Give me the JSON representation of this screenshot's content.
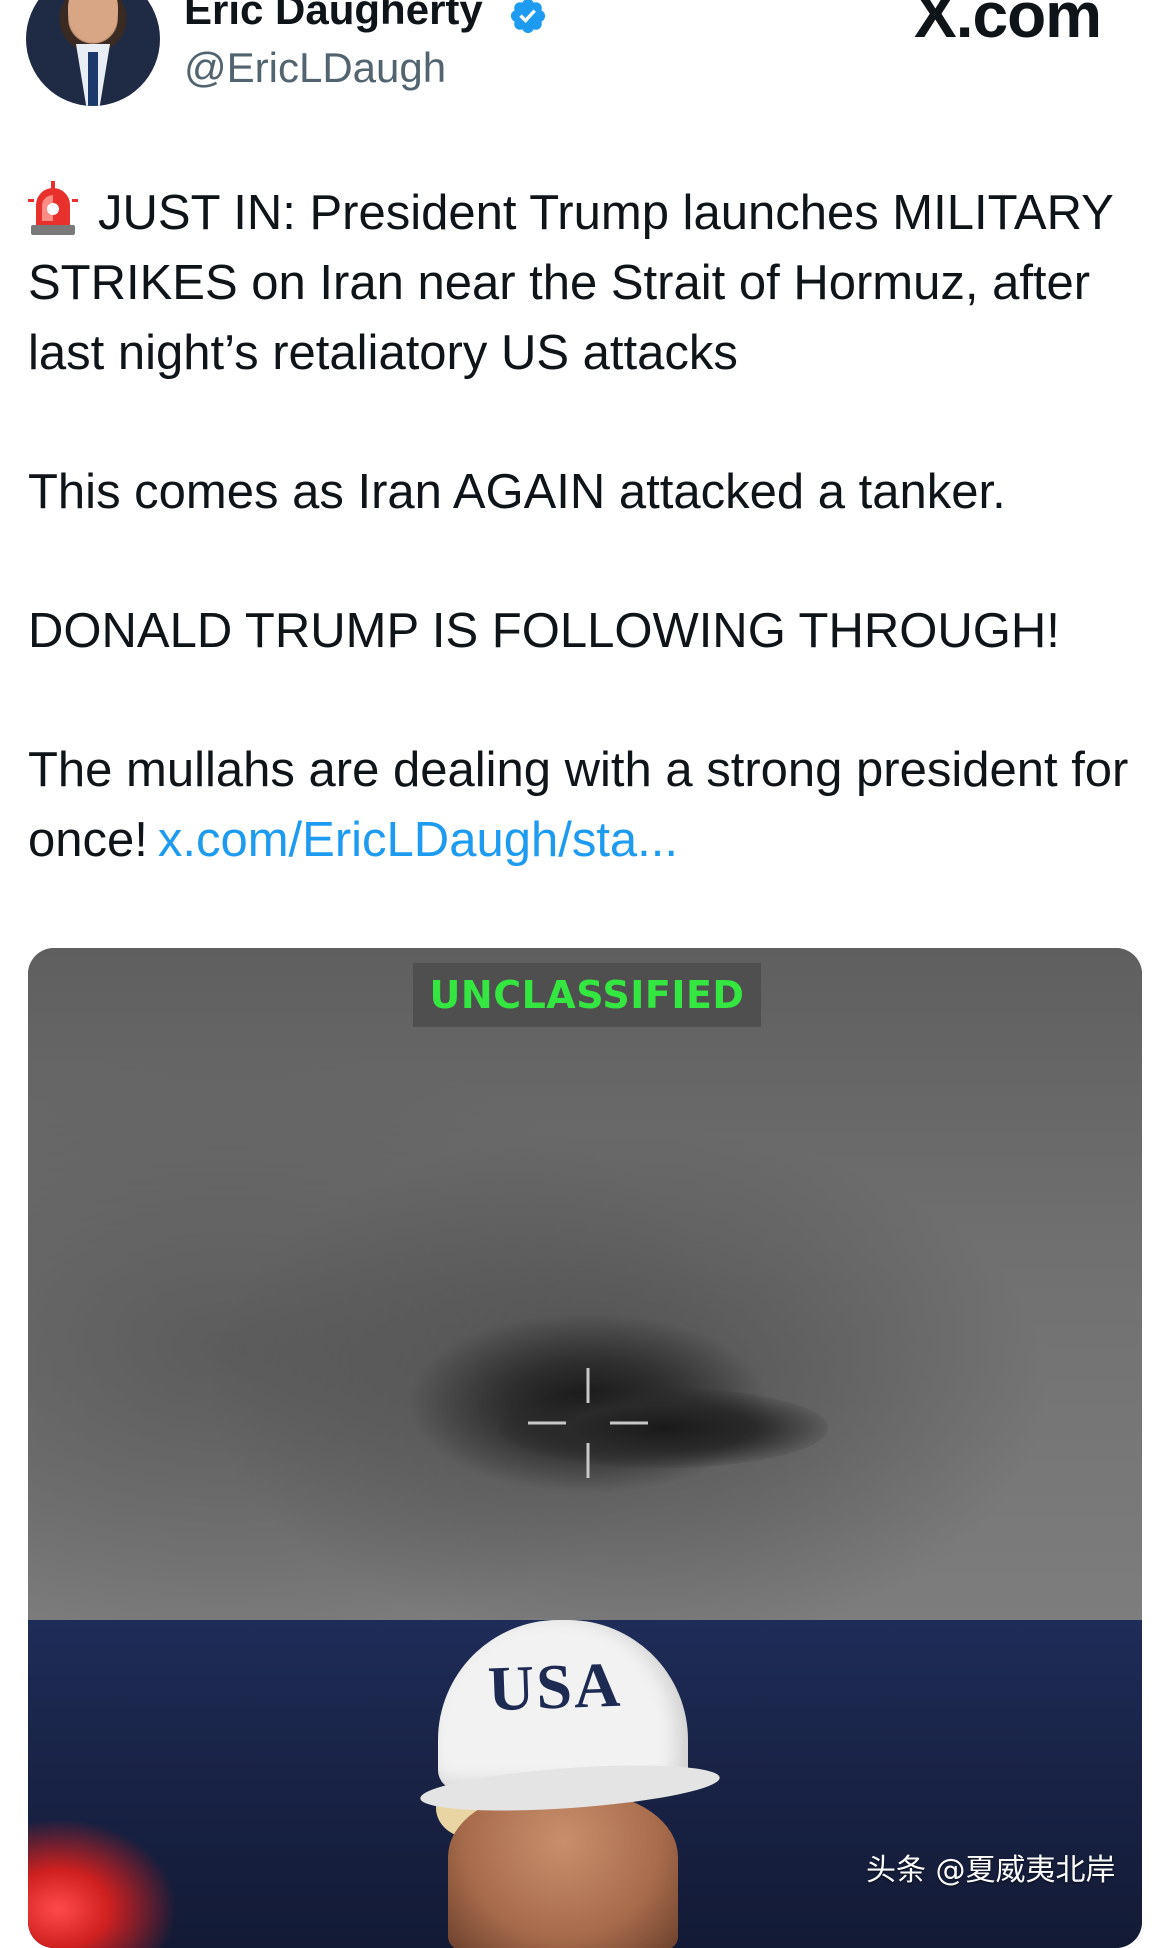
{
  "author": {
    "display_name": "Eric Daugherty",
    "handle": "@EricLDaugh"
  },
  "site_logo": "X.com",
  "tweet": {
    "line1_rest": "JUST IN: President Trump launches MILITARY STRIKES on Iran near the Strait of Hormuz, after last night’s retaliatory US attacks",
    "para2": "This comes as Iran AGAIN attacked a tanker.",
    "para3": "DONALD TRUMP IS FOLLOWING THROUGH!",
    "para4": "The mullahs are dealing with a strong president for once!",
    "link": "x.com/EricLDaugh/sta...",
    "emoji_icon": "rotating-light-icon"
  },
  "media": {
    "overlay_label": "UNCLASSIFIED",
    "cap_text": "USA"
  },
  "watermark": "头条 @夏威夷北岸",
  "colors": {
    "link": "#1d9bf0",
    "verified": "#1d9bf0",
    "unclassified_text": "#33e640"
  }
}
